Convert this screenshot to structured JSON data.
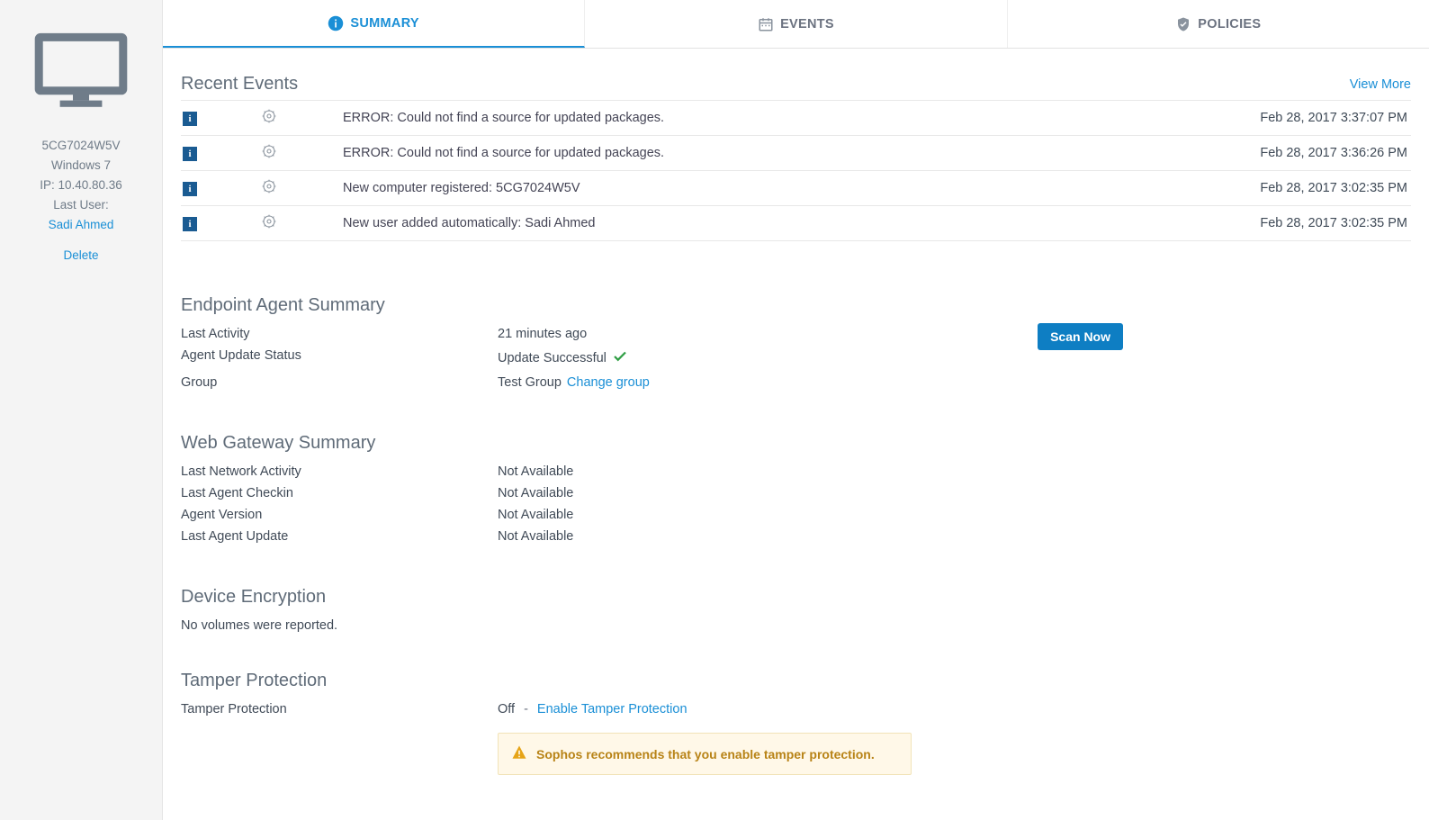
{
  "sidebar": {
    "hostname": "5CG7024W5V",
    "os": "Windows 7",
    "ip_label": "IP: 10.40.80.36",
    "last_user_label": "Last User:",
    "last_user_name": "Sadi Ahmed",
    "delete_label": "Delete"
  },
  "tabs": {
    "summary": "SUMMARY",
    "events": "EVENTS",
    "policies": "POLICIES"
  },
  "recent_events": {
    "heading": "Recent Events",
    "view_more": "View More",
    "rows": [
      {
        "msg": "ERROR: Could not find a source for updated packages.",
        "time": "Feb 28, 2017 3:37:07 PM"
      },
      {
        "msg": "ERROR: Could not find a source for updated packages.",
        "time": "Feb 28, 2017 3:36:26 PM"
      },
      {
        "msg": "New computer registered: 5CG7024W5V",
        "time": "Feb 28, 2017 3:02:35 PM"
      },
      {
        "msg": "New user added automatically: Sadi Ahmed",
        "time": "Feb 28, 2017 3:02:35 PM"
      }
    ]
  },
  "endpoint_summary": {
    "heading": "Endpoint Agent Summary",
    "last_activity_label": "Last Activity",
    "last_activity_value": "21 minutes ago",
    "update_status_label": "Agent Update Status",
    "update_status_value": "Update Successful",
    "group_label": "Group",
    "group_value": "Test Group",
    "change_group": "Change group",
    "scan_now": "Scan Now"
  },
  "web_gateway": {
    "heading": "Web Gateway Summary",
    "rows": [
      {
        "k": "Last Network Activity",
        "v": "Not Available"
      },
      {
        "k": "Last Agent Checkin",
        "v": "Not Available"
      },
      {
        "k": "Agent Version",
        "v": "Not Available"
      },
      {
        "k": "Last Agent Update",
        "v": "Not Available"
      }
    ]
  },
  "device_encryption": {
    "heading": "Device Encryption",
    "note": "No volumes were reported."
  },
  "tamper": {
    "heading": "Tamper Protection",
    "label": "Tamper Protection",
    "value": "Off",
    "sep": "-",
    "enable_link": "Enable Tamper Protection",
    "warning": "Sophos recommends that you enable tamper protection."
  }
}
